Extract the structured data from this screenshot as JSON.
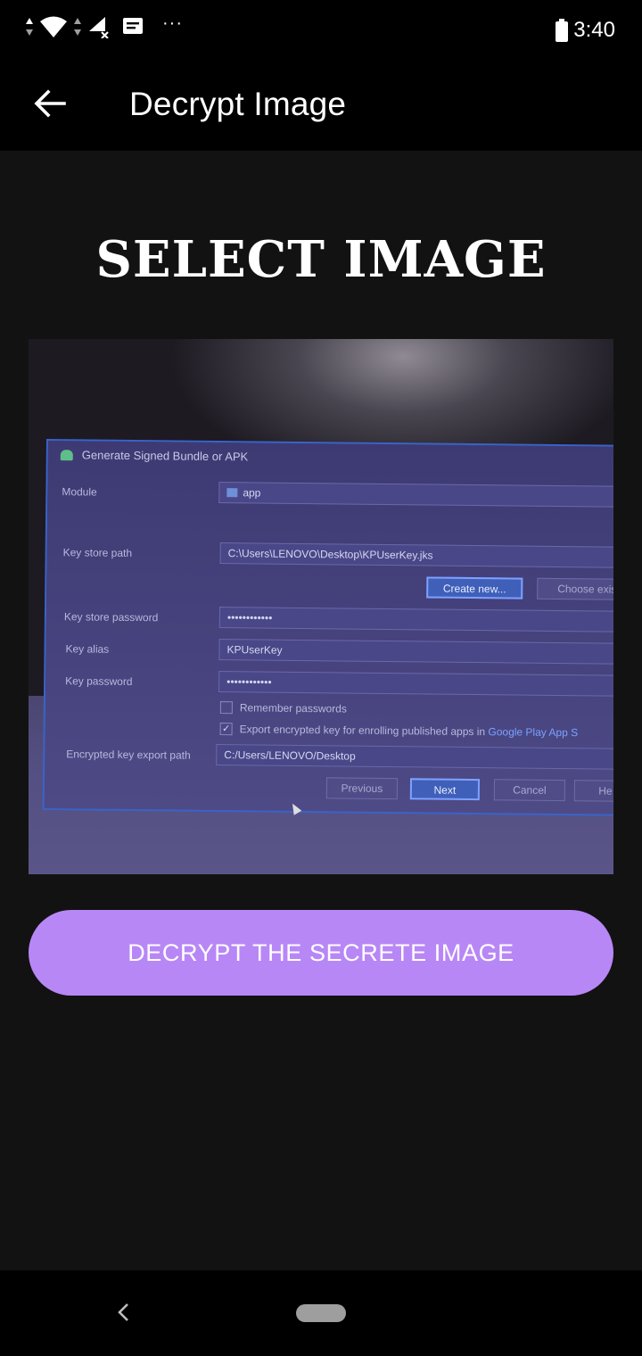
{
  "status_bar": {
    "time": "3:40",
    "more_indicator": "···",
    "icons": [
      "data-arrows-icon",
      "wifi-icon",
      "data-arrows-icon",
      "signal-no-sim-icon",
      "notification-message-icon",
      "battery-icon"
    ]
  },
  "app_bar": {
    "title": "Decrypt Image",
    "back_icon": "arrow-left-icon"
  },
  "main": {
    "heading": "SELECT IMAGE",
    "decrypt_button_label": "DECRYPT THE SECRETE IMAGE",
    "accent_color": "#b887f6"
  },
  "photo": {
    "dialog_title": "Generate Signed Bundle or APK",
    "module_label": "Module",
    "module_value": "app",
    "keystore_path_label": "Key store path",
    "keystore_path_value": "C:\\Users\\LENOVO\\Desktop\\KPUserKey.jks",
    "create_new_label": "Create new...",
    "choose_existing_label": "Choose exis",
    "keystore_password_label": "Key store password",
    "keystore_password_value": "••••••••••••",
    "key_alias_label": "Key alias",
    "key_alias_value": "KPUserKey",
    "key_password_label": "Key password",
    "key_password_value": "••••••••••••",
    "remember_passwords_label": "Remember passwords",
    "export_checkbox_check": "✓",
    "export_label": "Export encrypted key for enrolling published apps in",
    "export_link": "Google Play App S",
    "export_path_label": "Encrypted key export path",
    "export_path_value": "C:/Users/LENOVO/Desktop",
    "previous_label": "Previous",
    "next_label": "Next",
    "cancel_label": "Cancel",
    "help_label": "He"
  },
  "nav_bar": {
    "back_icon": "nav-back-icon",
    "home_icon": "nav-home-pill-icon"
  }
}
